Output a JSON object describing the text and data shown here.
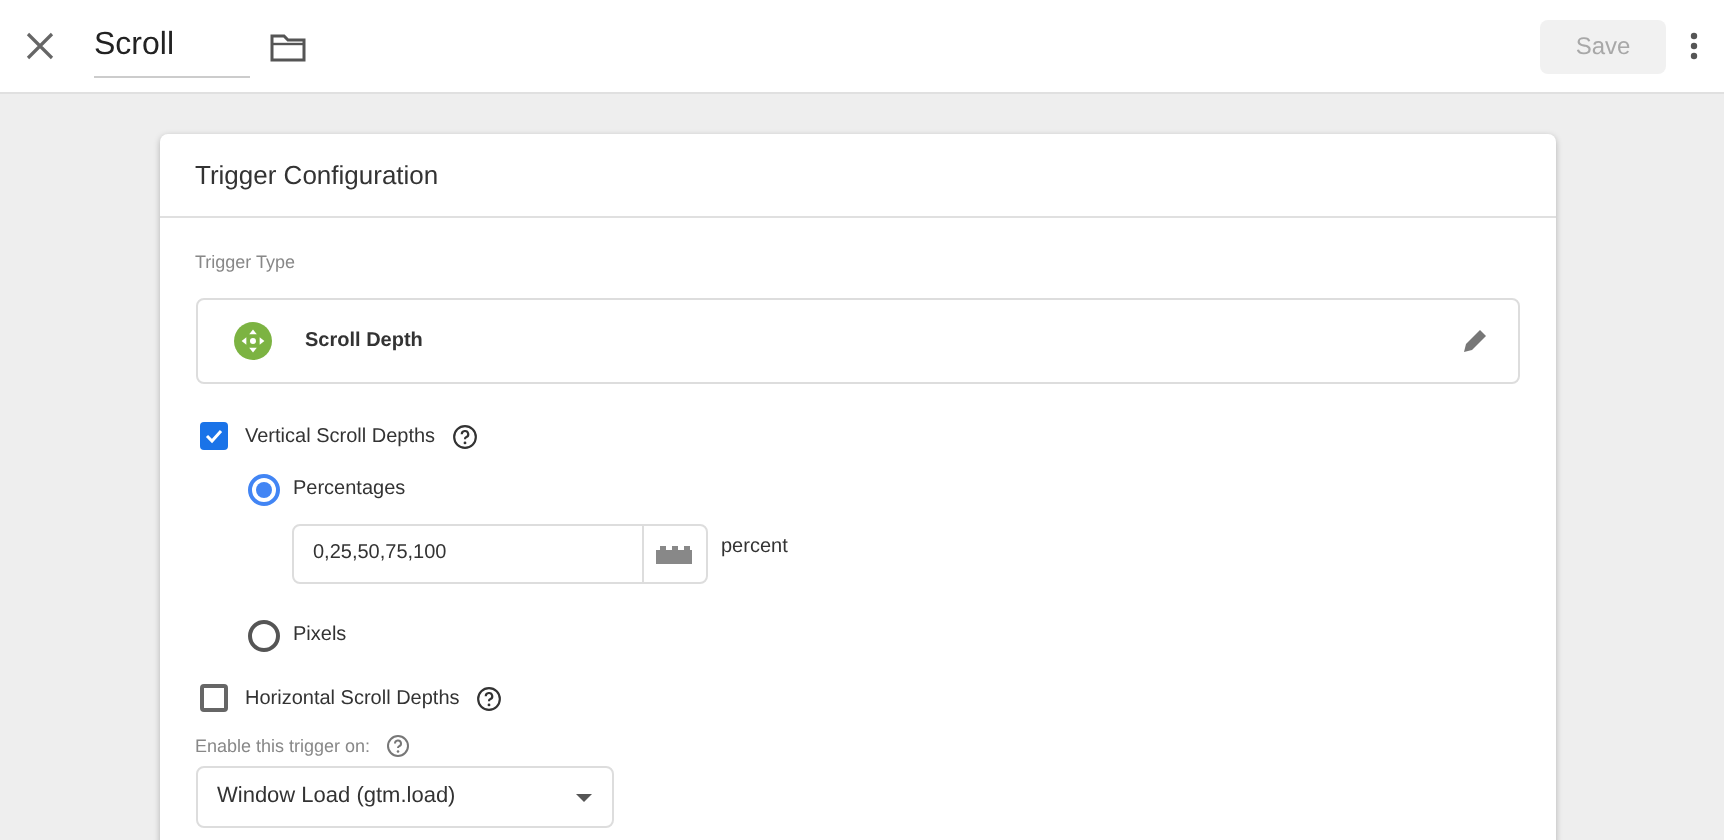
{
  "header": {
    "name": "Scroll",
    "save": {
      "label": "Save",
      "disabled": true
    }
  },
  "card": {
    "title": "Trigger Configuration",
    "trigger_type": {
      "label": "Trigger Type",
      "value": "Scroll Depth"
    },
    "depths": [
      {
        "label": "Vertical Scroll Depths",
        "checked": true,
        "options": [
          {
            "label": "Percentages",
            "selected": true,
            "value": "0,25,50,75,100",
            "unit": "percent"
          },
          {
            "label": "Pixels",
            "selected": false
          }
        ]
      },
      {
        "label": "Horizontal Scroll Depths",
        "checked": false
      }
    ],
    "enable_on": {
      "label": "Enable this trigger on:",
      "value": "Window Load (gtm.load)"
    }
  }
}
